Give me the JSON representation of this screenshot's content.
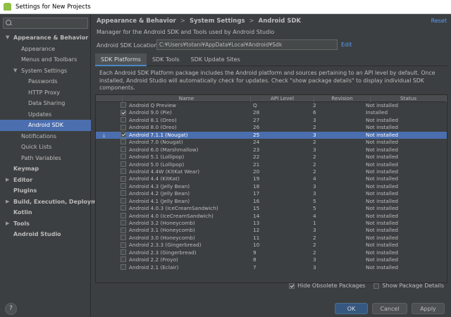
{
  "window": {
    "title": "Settings for New Projects"
  },
  "search": {
    "placeholder": "",
    "value": ""
  },
  "sidebar": {
    "items": [
      {
        "label": "Appearance & Behavior",
        "indent": 0,
        "arrow": "▼",
        "bold": true
      },
      {
        "label": "Appearance",
        "indent": 1
      },
      {
        "label": "Menus and Toolbars",
        "indent": 1
      },
      {
        "label": "System Settings",
        "indent": 1,
        "arrow": "▼"
      },
      {
        "label": "Passwords",
        "indent": 2
      },
      {
        "label": "HTTP Proxy",
        "indent": 2
      },
      {
        "label": "Data Sharing",
        "indent": 2
      },
      {
        "label": "Updates",
        "indent": 2
      },
      {
        "label": "Android SDK",
        "indent": 2,
        "selected": true
      },
      {
        "label": "Notifications",
        "indent": 1
      },
      {
        "label": "Quick Lists",
        "indent": 1
      },
      {
        "label": "Path Variables",
        "indent": 1
      },
      {
        "label": "Keymap",
        "indent": 0,
        "bold": true
      },
      {
        "label": "Editor",
        "indent": 0,
        "arrow": "▶",
        "bold": true
      },
      {
        "label": "Plugins",
        "indent": 0,
        "bold": true
      },
      {
        "label": "Build, Execution, Deployment",
        "indent": 0,
        "arrow": "▶",
        "bold": true
      },
      {
        "label": "Kotlin",
        "indent": 0,
        "bold": true
      },
      {
        "label": "Tools",
        "indent": 0,
        "arrow": "▶",
        "bold": true
      },
      {
        "label": "Android Studio",
        "indent": 0,
        "bold": true
      }
    ]
  },
  "header": {
    "breadcrumb": [
      "Appearance & Behavior",
      "System Settings",
      "Android SDK"
    ],
    "separator": ">",
    "reset": "Reset",
    "subtitle": "Manager for the Android SDK and Tools used by Android Studio"
  },
  "sdk_location": {
    "label": "Android SDK Location:",
    "value": "C:¥Users¥totani¥AppData¥Local¥Android¥Sdk",
    "edit": "Edit"
  },
  "tabs": [
    {
      "label": "SDK Platforms",
      "active": true
    },
    {
      "label": "SDK Tools"
    },
    {
      "label": "SDK Update Sites"
    }
  ],
  "description": "Each Android SDK Platform package includes the Android platform and sources pertaining to an API level by default. Once installed, Android Studio will automatically check for updates. Check \"show package details\" to display individual SDK components.",
  "table": {
    "columns": [
      "Name",
      "API Level",
      "Revision",
      "Status"
    ],
    "rows": [
      {
        "name": "Android Q Preview",
        "api": "Q",
        "rev": "2",
        "status": "Not installed",
        "checked": false
      },
      {
        "name": "Android 9.0 (Pie)",
        "api": "28",
        "rev": "6",
        "status": "Installed",
        "checked": true
      },
      {
        "name": "Android 8.1 (Oreo)",
        "api": "27",
        "rev": "3",
        "status": "Not installed",
        "checked": false
      },
      {
        "name": "Android 8.0 (Oreo)",
        "api": "26",
        "rev": "2",
        "status": "Not installed",
        "checked": false
      },
      {
        "name": "Android 7.1.1 (Nougat)",
        "api": "25",
        "rev": "3",
        "status": "Not installed",
        "checked": true,
        "selected": true,
        "download": true
      },
      {
        "name": "Android 7.0 (Nougat)",
        "api": "24",
        "rev": "2",
        "status": "Not installed",
        "checked": false
      },
      {
        "name": "Android 6.0 (Marshmallow)",
        "api": "23",
        "rev": "3",
        "status": "Not installed",
        "checked": false
      },
      {
        "name": "Android 5.1 (Lollipop)",
        "api": "22",
        "rev": "2",
        "status": "Not installed",
        "checked": false
      },
      {
        "name": "Android 5.0 (Lollipop)",
        "api": "21",
        "rev": "2",
        "status": "Not installed",
        "checked": false
      },
      {
        "name": "Android 4.4W (KitKat Wear)",
        "api": "20",
        "rev": "2",
        "status": "Not installed",
        "checked": false
      },
      {
        "name": "Android 4.4 (KitKat)",
        "api": "19",
        "rev": "4",
        "status": "Not installed",
        "checked": false
      },
      {
        "name": "Android 4.3 (Jelly Bean)",
        "api": "18",
        "rev": "3",
        "status": "Not installed",
        "checked": false
      },
      {
        "name": "Android 4.2 (Jelly Bean)",
        "api": "17",
        "rev": "3",
        "status": "Not installed",
        "checked": false
      },
      {
        "name": "Android 4.1 (Jelly Bean)",
        "api": "16",
        "rev": "5",
        "status": "Not installed",
        "checked": false
      },
      {
        "name": "Android 4.0.3 (IceCreamSandwich)",
        "api": "15",
        "rev": "5",
        "status": "Not installed",
        "checked": false
      },
      {
        "name": "Android 4.0 (IceCreamSandwich)",
        "api": "14",
        "rev": "4",
        "status": "Not installed",
        "checked": false
      },
      {
        "name": "Android 3.2 (Honeycomb)",
        "api": "13",
        "rev": "1",
        "status": "Not installed",
        "checked": false
      },
      {
        "name": "Android 3.1 (Honeycomb)",
        "api": "12",
        "rev": "3",
        "status": "Not installed",
        "checked": false
      },
      {
        "name": "Android 3.0 (Honeycomb)",
        "api": "11",
        "rev": "2",
        "status": "Not installed",
        "checked": false
      },
      {
        "name": "Android 2.3.3 (Gingerbread)",
        "api": "10",
        "rev": "2",
        "status": "Not installed",
        "checked": false
      },
      {
        "name": "Android 2.3 (Gingerbread)",
        "api": "9",
        "rev": "2",
        "status": "Not installed",
        "checked": false
      },
      {
        "name": "Android 2.2 (Froyo)",
        "api": "8",
        "rev": "3",
        "status": "Not installed",
        "checked": false
      },
      {
        "name": "Android 2.1 (Eclair)",
        "api": "7",
        "rev": "3",
        "status": "Not installed",
        "checked": false
      }
    ]
  },
  "options": {
    "hide_obsolete": {
      "label": "Hide Obsolete Packages",
      "checked": true
    },
    "show_details": {
      "label": "Show Package Details",
      "checked": false
    }
  },
  "footer": {
    "help": "?",
    "ok": "OK",
    "cancel": "Cancel",
    "apply": "Apply"
  },
  "colors": {
    "selection": "#4b6eaf",
    "link": "#589df6",
    "background": "#3c3f41"
  }
}
